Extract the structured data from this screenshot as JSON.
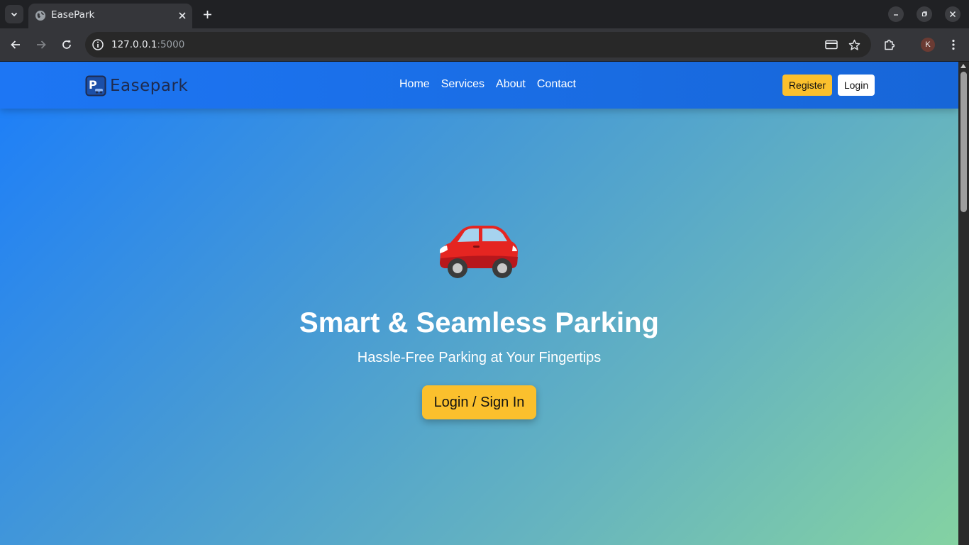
{
  "browser": {
    "tab_title": "EasePark",
    "url_host": "127.0.0.1",
    "url_port": ":5000",
    "profile_initial": "K"
  },
  "navbar": {
    "brand": "Easepark",
    "links": [
      "Home",
      "Services",
      "About",
      "Contact"
    ],
    "register_label": "Register",
    "login_label": "Login"
  },
  "hero": {
    "icon": "car-icon",
    "title": "Smart & Seamless Parking",
    "subtitle": "Hassle-Free Parking at Your Fingertips",
    "cta_label": "Login / Sign In"
  },
  "colors": {
    "nav_blue": "#1d76f4",
    "accent_yellow": "#fbc02d",
    "gradient_start": "#1b7dfa",
    "gradient_end": "#84d2a2",
    "brand_text": "#1e2b4f"
  }
}
